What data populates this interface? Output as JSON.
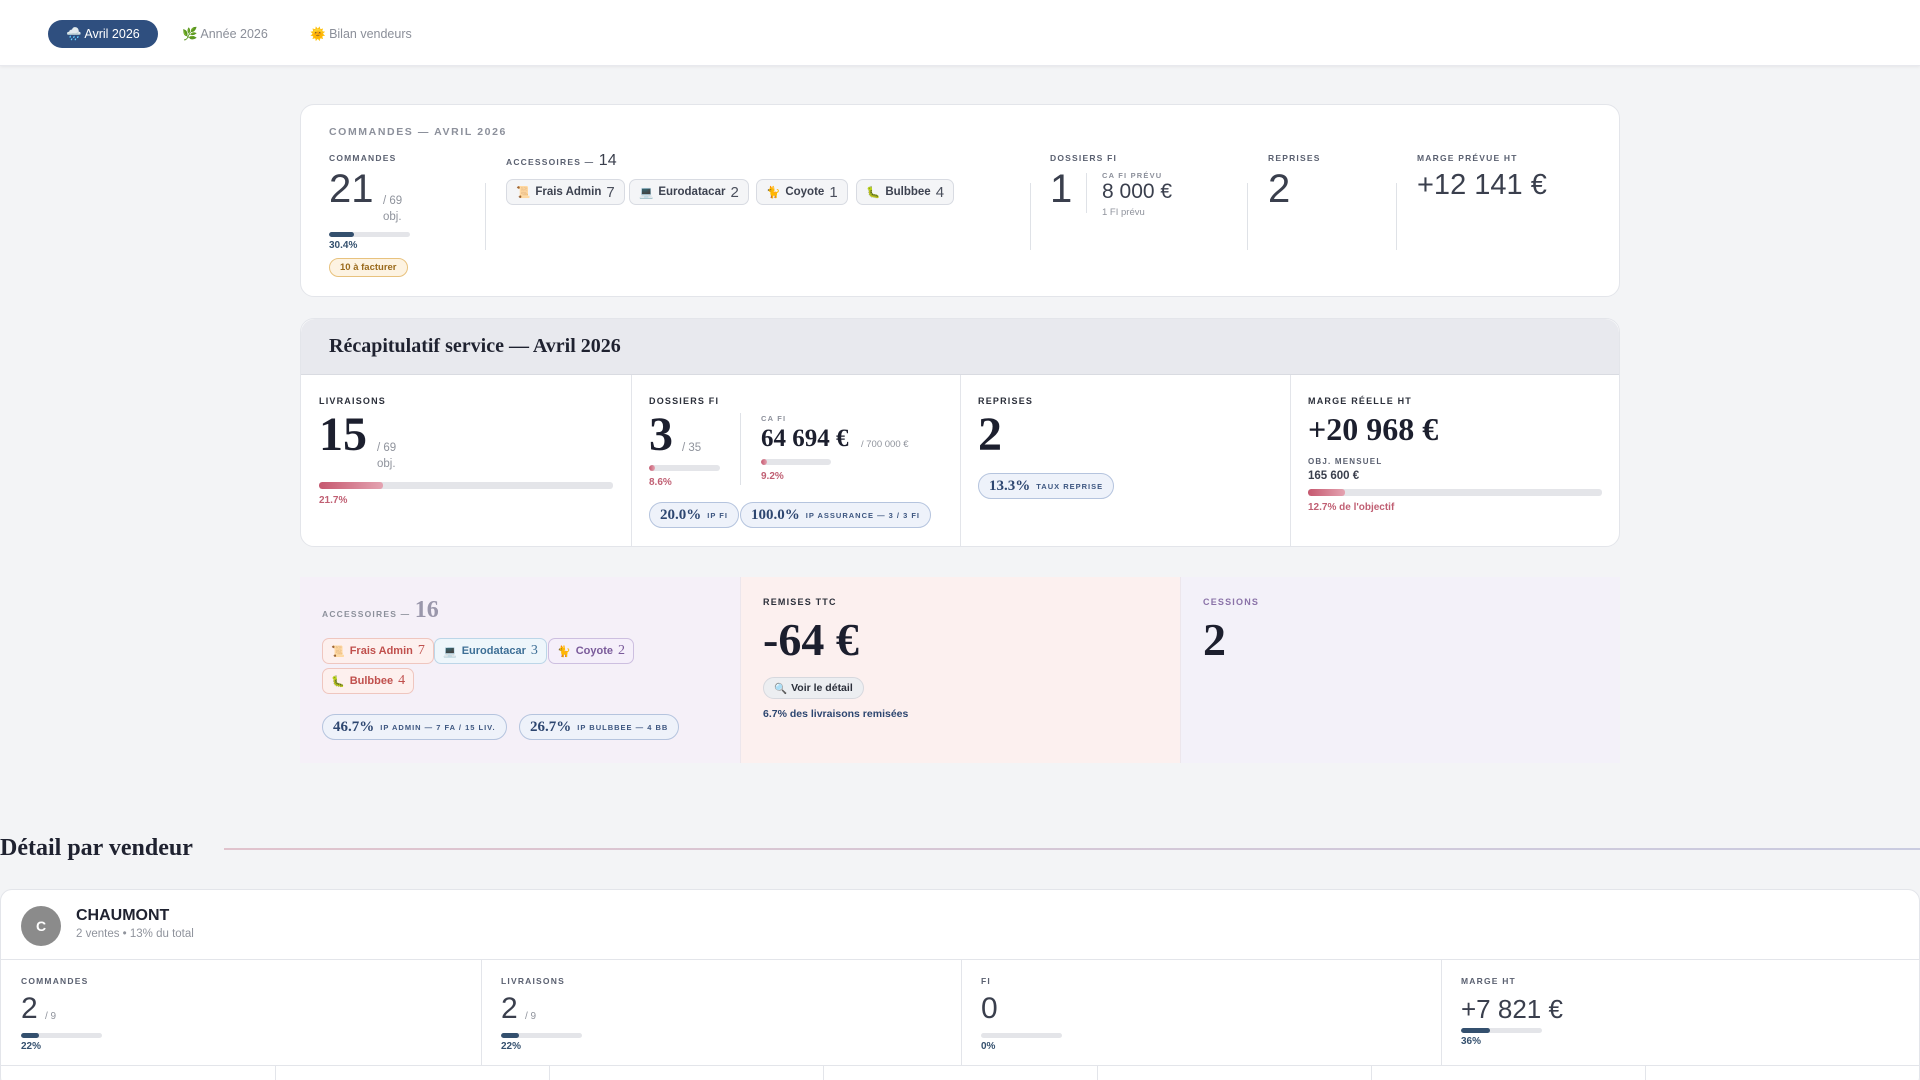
{
  "tabs": [
    {
      "icon": "🌧️",
      "label": "Avril 2026"
    },
    {
      "icon": "🌿",
      "label": "Année 2026"
    },
    {
      "icon": "🌞",
      "label": "Bilan vendeurs"
    }
  ],
  "orders_card": {
    "title": "COMMANDES — AVRIL 2026",
    "commandes": {
      "label": "COMMANDES",
      "value": "21",
      "objective": "/ 69",
      "obj_word": "obj.",
      "progress": 0.304,
      "pct": "30.4%",
      "badge": "10 à facturer"
    },
    "accessoires": {
      "label": "ACCESSOIRES —",
      "total": "14",
      "items": [
        {
          "icon": "📜",
          "name": "Frais Admin",
          "count": "7"
        },
        {
          "icon": "💻",
          "name": "Eurodatacar",
          "count": "2"
        },
        {
          "icon": "🐈",
          "name": "Coyote",
          "count": "1"
        },
        {
          "icon": "🐛",
          "name": "Bulbbee",
          "count": "4"
        }
      ]
    },
    "dossiers_fi": {
      "label": "DOSSIERS FI",
      "value": "1",
      "ca_label": "CA FI PRÉVU",
      "ca_value": "8 000 €",
      "sub": "1 FI prévu"
    },
    "reprises": {
      "label": "REPRISES",
      "value": "2"
    },
    "marge": {
      "label": "MARGE PRÉVUE HT",
      "value": "+12 141 €"
    }
  },
  "service": {
    "title": "Récapitulatif service — Avril 2026",
    "livraisons": {
      "label": "LIVRAISONS",
      "value": "15",
      "objective": "/ 69",
      "obj_word": "obj.",
      "progress": 0.217,
      "pct": "21.7%"
    },
    "dossiers_fi": {
      "label": "DOSSIERS FI",
      "value": "3",
      "objective": "/ 35",
      "progress": 0.086,
      "pct": "8.6%",
      "ca_label": "CA FI",
      "ca_value": "64 694 €",
      "ca_objective": "/ 700 000 €",
      "ca_progress": 0.092,
      "ca_pct": "9.2%",
      "badges": [
        {
          "value": "20.0%",
          "text": "IP FI"
        },
        {
          "value": "100.0%",
          "text": "IP ASSURANCE — 3 / 3 FI"
        }
      ]
    },
    "reprises": {
      "label": "REPRISES",
      "value": "2",
      "badge_value": "13.3%",
      "badge_text": "TAUX REPRISE"
    },
    "marge": {
      "label": "MARGE RÉELLE HT",
      "value": "+20 968 €",
      "obj_label": "OBJ. MENSUEL",
      "obj_value": "165 600 €",
      "progress": 0.127,
      "pct": "12.7% de l'objectif"
    }
  },
  "lower": {
    "accessoires": {
      "label": "ACCESSOIRES —",
      "total": "16",
      "items": [
        {
          "icon": "📜",
          "name": "Frais Admin",
          "count": "7",
          "color": "#c0504d",
          "bg": "#fdf0ee",
          "border": "#efc6bf"
        },
        {
          "icon": "💻",
          "name": "Eurodatacar",
          "count": "3",
          "color": "#3e6f96",
          "bg": "#eef6fb",
          "border": "#bcd6e8"
        },
        {
          "icon": "🐈",
          "name": "Coyote",
          "count": "2",
          "color": "#7a5a9a",
          "bg": "#f5effa",
          "border": "#cdbfe0"
        },
        {
          "icon": "🐛",
          "name": "Bulbbee",
          "count": "4",
          "color": "#c0504d",
          "bg": "#fdf0ee",
          "border": "#efc6bf"
        }
      ],
      "badges": [
        {
          "value": "46.7%",
          "text": "IP ADMIN — 7 FA / 15 LIV."
        },
        {
          "value": "26.7%",
          "text": "IP BULBBEE — 4 BB"
        }
      ]
    },
    "remises": {
      "label": "REMISES TTC",
      "value": "-64 €",
      "button": "Voir le détail",
      "button_icon": "🔍",
      "note": "6.7% des livraisons remisées"
    },
    "cessions": {
      "label": "CESSIONS",
      "value": "2"
    }
  },
  "vendor_section": {
    "title": "Détail par vendeur",
    "vendor": {
      "initial": "C",
      "name": "CHAUMONT",
      "sub": "2 ventes • 13% du total",
      "stats": [
        {
          "label": "COMMANDES",
          "value": "2",
          "objective": "/ 9",
          "progress": 0.22,
          "pct": "22%"
        },
        {
          "label": "LIVRAISONS",
          "value": "2",
          "objective": "/ 9",
          "progress": 0.22,
          "pct": "22%"
        },
        {
          "label": "FI",
          "value": "0",
          "objective": "",
          "progress": 0.0,
          "pct": "0%"
        },
        {
          "label": "MARGE HT",
          "value": "+7 821 €",
          "objective": "",
          "progress": 0.36,
          "pct": "36%"
        }
      ]
    }
  },
  "colors": {
    "navy": "#2f4f7f",
    "rose": "#c05f73",
    "accent_bar": "#34506e"
  }
}
